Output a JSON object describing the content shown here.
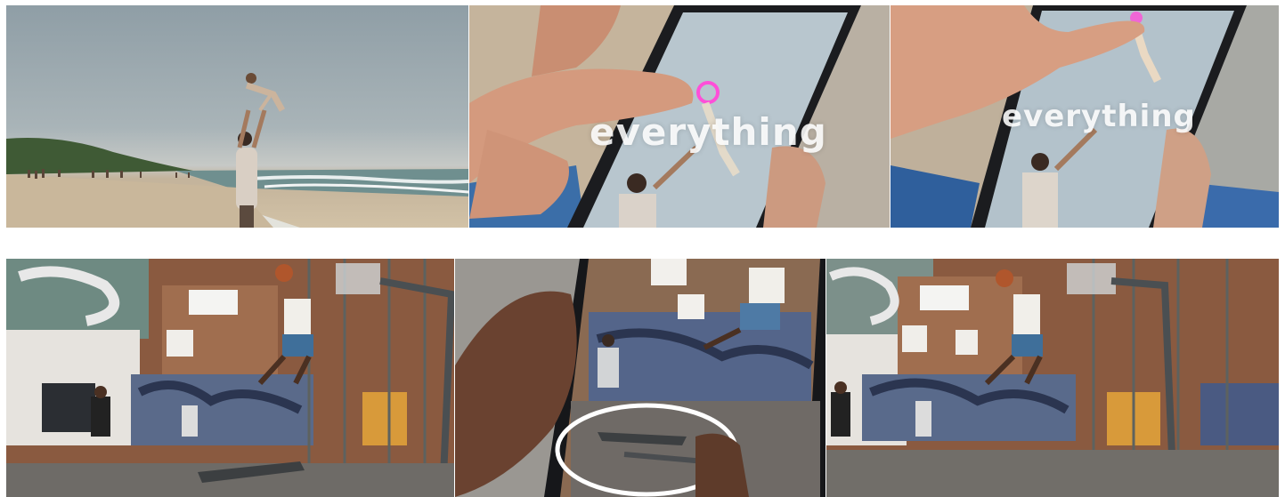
{
  "frames": [
    {
      "id": "beach-wide",
      "caption": ""
    },
    {
      "id": "phone-circle-beach",
      "overlay_text": "everything"
    },
    {
      "id": "phone-result-beach",
      "overlay_text": "everything"
    },
    {
      "id": "court-wide",
      "caption": ""
    },
    {
      "id": "phone-circle-court",
      "caption": ""
    },
    {
      "id": "court-result",
      "caption": ""
    }
  ],
  "colors": {
    "sky": "#9aa7ad",
    "sea": "#6f8f8f",
    "sand": "#d2c2a6",
    "brick": "#8a5a40",
    "asphalt": "#6e6b67",
    "circle_highlight": "#ff4fd8",
    "circle_white": "#ffffff"
  }
}
